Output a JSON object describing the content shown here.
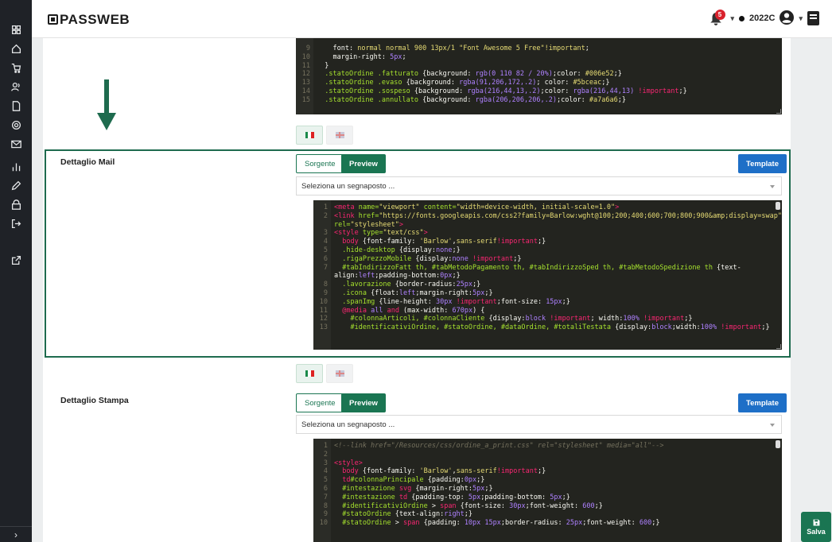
{
  "app": {
    "logo": "PASSWEB"
  },
  "header": {
    "notifications": "5",
    "company": "2022C"
  },
  "sidebar": {
    "icons": [
      "dashboard-icon",
      "home-icon",
      "cart-icon",
      "users-icon",
      "document-icon",
      "settings-icon",
      "mail-icon",
      "chart-icon",
      "pen-icon",
      "lock-icon",
      "logout-icon",
      "external-link-icon"
    ],
    "bottom": "›"
  },
  "top_editor": {
    "lines": [
      {
        "n": "9",
        "html": "    <span class=\"w\">font:</span> <span class=\"s\">normal normal 900 13px/1 \"Font Awesome 5 Free\"!important</span>;"
      },
      {
        "n": "10",
        "html": "    <span class=\"w\">margin-right:</span> <span class=\"n\">5px</span>;"
      },
      {
        "n": "11",
        "html": "  }"
      },
      {
        "n": "12",
        "html": "  <span class=\"p\">.statoOrdine .fatturato</span> {background: <span class=\"n\">rgb(0 110 82 / 20%)</span>;color: <span class=\"s\">#006e52</span>;}"
      },
      {
        "n": "13",
        "html": "  <span class=\"p\">.statoOrdine .evaso</span> {background: <span class=\"n\">rgba(91,206,172,.2)</span>; color: <span class=\"s\">#5bceac</span>;}"
      },
      {
        "n": "14",
        "html": "  <span class=\"p\">.statoOrdine .sospeso</span> {background: <span class=\"n\">rgba(216,44,13,.2)</span>;color: <span class=\"n\">rgba(216,44,13)</span> <span class=\"k\">!important</span>;}"
      },
      {
        "n": "15",
        "html": "  <span class=\"p\">.statoOrdine .annullato</span> {background: <span class=\"n\">rgba(206,206,206,.2)</span>;color: <span class=\"s\">#a7a6a6</span>;}"
      }
    ]
  },
  "mail": {
    "label": "Dettaglio Mail",
    "source_btn": "Sorgente",
    "preview_btn": "Preview",
    "template_btn": "Template",
    "placeholder_select": "Seleziona un segnaposto ...",
    "lines": [
      {
        "n": "1",
        "html": "<span class=\"k\">&lt;meta</span> <span class=\"a\">name=</span><span class=\"s\">\"viewport\"</span> <span class=\"a\">content=</span><span class=\"s\">\"width=device-width, initial-scale=1.0\"</span><span class=\"k\">&gt;</span>"
      },
      {
        "n": "2",
        "html": "<span class=\"k\">&lt;link</span> <span class=\"a\">href=</span><span class=\"s\">\"https://fonts.googleapis.com/css2?family=Barlow:wght@100;200;400;600;700;800;900&amp;amp;display=swap\"</span>"
      },
      {
        "n": "",
        "html": "<span class=\"a\">rel=</span><span class=\"s\">\"stylesheet\"</span><span class=\"k\">&gt;</span>"
      },
      {
        "n": "3",
        "html": "<span class=\"k\">&lt;style</span> <span class=\"a\">type=</span><span class=\"s\">\"text/css\"</span><span class=\"k\">&gt;</span>"
      },
      {
        "n": "4",
        "html": "  <span class=\"k\">body</span> {font-family: <span class=\"s\">'Barlow'</span>,<span class=\"s\">sans-serif</span><span class=\"k\">!important</span>;}"
      },
      {
        "n": "5",
        "html": "  <span class=\"p\">.hide-desktop</span> {display:<span class=\"n\">none</span>;}"
      },
      {
        "n": "6",
        "html": "  <span class=\"p\">.rigaPrezzoMobile</span> {display:<span class=\"n\">none</span> <span class=\"k\">!important</span>;}"
      },
      {
        "n": "7",
        "html": "  <span class=\"p\">#tabIndirizzoFatt th, #tabMetodoPagamento th, #tabIndirizzoSped th, #tabMetodoSpedizione th</span> {text-"
      },
      {
        "n": "",
        "html": "align:<span class=\"n\">left</span>;padding-bottom:<span class=\"n\">0px</span>;}"
      },
      {
        "n": "8",
        "html": "  <span class=\"p\">.lavorazione</span> {border-radius:<span class=\"n\">25px</span>;}"
      },
      {
        "n": "9",
        "html": "  <span class=\"p\">.icona</span> {float:<span class=\"n\">left</span>;margin-right:<span class=\"n\">5px</span>;}"
      },
      {
        "n": "10",
        "html": "  <span class=\"p\">.spanImg</span> {line-height: <span class=\"n\">30px</span> <span class=\"k\">!important</span>;font-size: <span class=\"n\">15px</span>;}"
      },
      {
        "n": "11",
        "html": "  <span class=\"k\">@media</span> <span class=\"n\">all</span> <span class=\"k\">and</span> (max-width: <span class=\"n\">670px</span>) {"
      },
      {
        "n": "12",
        "html": "    <span class=\"p\">#colonnaArticoli, #colonnaCliente</span> {display:<span class=\"n\">block</span> <span class=\"k\">!important</span>; width:<span class=\"n\">100%</span> <span class=\"k\">!important</span>;}"
      },
      {
        "n": "13",
        "html": "    <span class=\"p\">#identificativiOrdine, #statoOrdine, #dataOrdine, #totaliTestata</span> {display:<span class=\"n\">block</span>;width:<span class=\"n\">100%</span> <span class=\"k\">!important</span>;}"
      }
    ]
  },
  "print": {
    "label": "Dettaglio Stampa",
    "source_btn": "Sorgente",
    "preview_btn": "Preview",
    "template_btn": "Template",
    "placeholder_select": "Seleziona un segnaposto ...",
    "lines": [
      {
        "n": "1",
        "html": "<span class=\"c\">&lt;!--link href=\"/Resources/css/ordine_a_print.css\" rel=\"stylesheet\" media=\"all\"--&gt;</span>"
      },
      {
        "n": "2",
        "html": ""
      },
      {
        "n": "3",
        "html": "<span class=\"k\">&lt;style&gt;</span>"
      },
      {
        "n": "4",
        "html": "  <span class=\"k\">body</span> {font-family: <span class=\"s\">'Barlow'</span>,<span class=\"s\">sans-serif</span><span class=\"k\">!important</span>;}"
      },
      {
        "n": "5",
        "html": "  <span class=\"k\">td</span><span class=\"p\">#colonnaPrincipale</span> {padding:<span class=\"n\">0px</span>;}"
      },
      {
        "n": "6",
        "html": "  <span class=\"p\">#intestazione</span> <span class=\"k\">svg</span> {margin-right:<span class=\"n\">5px</span>;}"
      },
      {
        "n": "7",
        "html": "  <span class=\"p\">#intestazione</span> <span class=\"k\">td</span> {padding-top: <span class=\"n\">5px</span>;padding-bottom: <span class=\"n\">5px</span>;}"
      },
      {
        "n": "8",
        "html": "  <span class=\"p\">#identificativiOrdine</span> &gt; <span class=\"k\">span</span> {font-size: <span class=\"n\">30px</span>;font-weight: <span class=\"n\">600</span>;}"
      },
      {
        "n": "9",
        "html": "  <span class=\"p\">#statoOrdine</span> {text-align:<span class=\"n\">right</span>;}"
      },
      {
        "n": "10",
        "html": "  <span class=\"p\">#statoOrdine</span> &gt; <span class=\"k\">span</span> {padding: <span class=\"n\">10px 15px</span>;border-radius: <span class=\"n\">25px</span>;font-weight: <span class=\"n\">600</span>;}"
      }
    ]
  },
  "save": {
    "label": "Salva"
  }
}
